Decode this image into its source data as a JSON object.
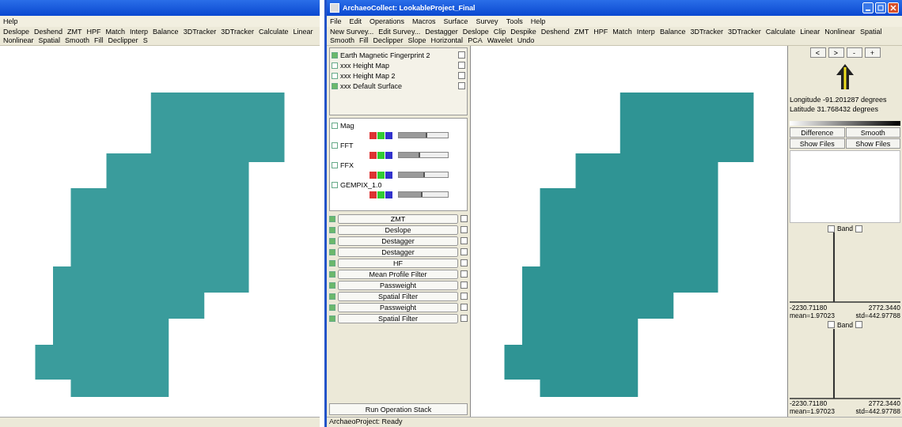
{
  "left_window": {
    "menu": [
      "Help"
    ],
    "toolbar": [
      "Deslope",
      "Deshend",
      "ZMT",
      "HPF",
      "Match",
      "Interp",
      "Balance",
      "3DTracker",
      "3DTracker",
      "Calculate",
      "Linear",
      "Nonlinear",
      "Spatial",
      "Smooth",
      "Fill",
      "Declipper",
      "S"
    ]
  },
  "window": {
    "title": "ArchaeoCollect: LookableProject_Final"
  },
  "menu": [
    "File",
    "Edit",
    "Operations",
    "Macros",
    "Surface",
    "Survey",
    "Tools",
    "Help"
  ],
  "toolbar": [
    "New Survey...",
    "Edit Survey...",
    "Destagger",
    "Deslope",
    "Clip",
    "Despike",
    "Deshend",
    "ZMT",
    "HPF",
    "Match",
    "Interp",
    "Balance",
    "3DTracker",
    "3DTracker",
    "Calculate",
    "Linear",
    "Nonlinear",
    "Spatial",
    "Smooth",
    "Fill",
    "Declipper",
    "Slope",
    "Horizontal",
    "PCA",
    "Wavelet",
    "Undo"
  ],
  "layers": [
    {
      "label": "Earth Magnetic Fingerprint 2",
      "checked": true
    },
    {
      "label": "xxx Height Map",
      "checked": false
    },
    {
      "label": "xxx Height Map 2",
      "checked": false
    },
    {
      "label": "xxx Default Surface",
      "checked": true
    }
  ],
  "images": [
    {
      "label": "Mag",
      "checked": false,
      "level": 0.55
    },
    {
      "label": "FFT",
      "checked": false,
      "level": 0.4
    },
    {
      "label": "FFX",
      "checked": false,
      "level": 0.5
    },
    {
      "label": "GEMPIX_1.0",
      "checked": false,
      "level": 0.45
    }
  ],
  "operations": [
    {
      "label": "ZMT",
      "checked": true
    },
    {
      "label": "Deslope",
      "checked": true
    },
    {
      "label": "Destagger",
      "checked": true
    },
    {
      "label": "Destagger",
      "checked": true
    },
    {
      "label": "HF",
      "checked": true
    },
    {
      "label": "Mean Profile Filter",
      "checked": true
    },
    {
      "label": "Passweight",
      "checked": true
    },
    {
      "label": "Spatial Filter",
      "checked": true
    },
    {
      "label": "Passweight",
      "checked": true
    },
    {
      "label": "Spatial Filter",
      "checked": true
    }
  ],
  "run_button": "Run Operation Stack",
  "status_bar": "ArchaeoProject: Ready",
  "nav_buttons": [
    "<",
    ">",
    "-",
    "+"
  ],
  "coordinates": [
    "Longitude -91.201287 degrees",
    "Latitude 31.768432 degrees"
  ],
  "view_buttons": [
    "Difference",
    "Smooth",
    "Show Files",
    "Show Files"
  ],
  "histograms": [
    {
      "title": "Band",
      "min": "-2230.71180",
      "max": "2772.3440",
      "mean": "mean=1.97023",
      "std": "std=442.97788"
    },
    {
      "title": "Band",
      "min": "-2230.71180",
      "max": "2772.3440",
      "mean": "mean=1.97023",
      "std": "std=442.97788"
    }
  ]
}
